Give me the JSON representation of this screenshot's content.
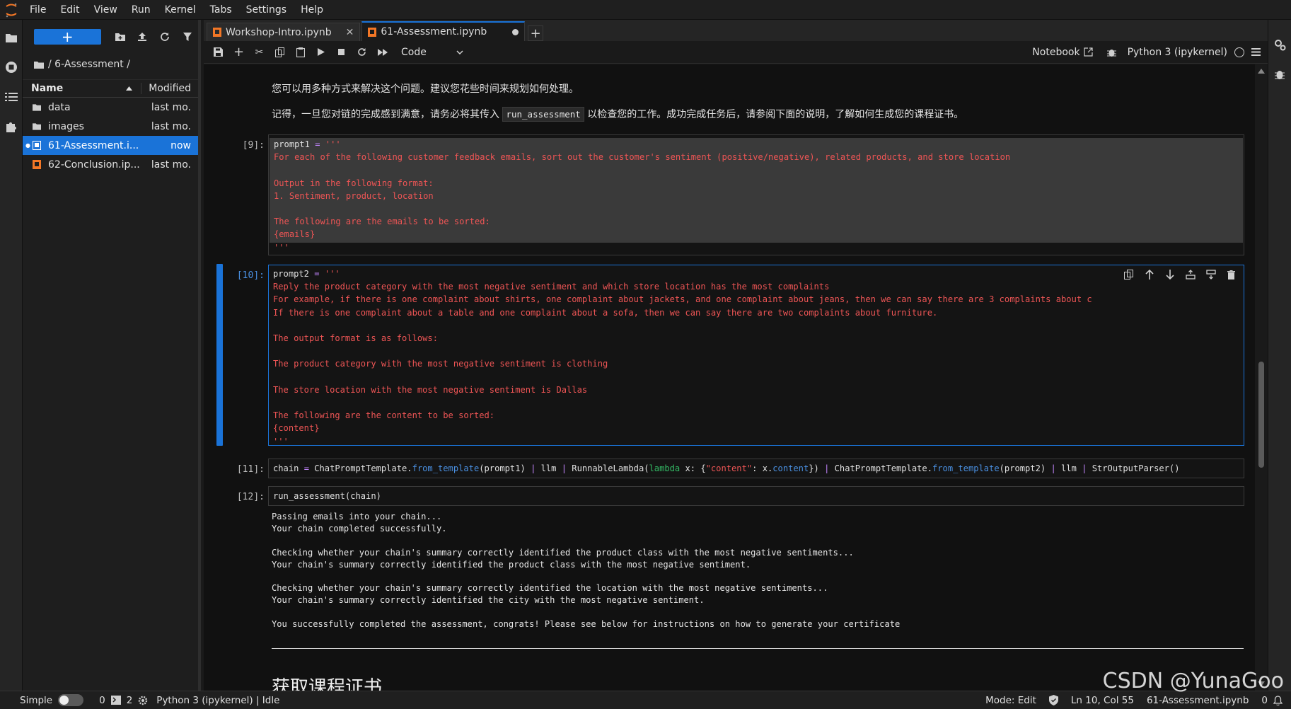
{
  "menubar": {
    "items": [
      "File",
      "Edit",
      "View",
      "Run",
      "Kernel",
      "Tabs",
      "Settings",
      "Help"
    ]
  },
  "filebrowser": {
    "new_label": "+",
    "path": "/ 6-Assessment /",
    "col_name": "Name",
    "col_modified": "Modified",
    "items": [
      {
        "name": "data",
        "modified": "last mo.",
        "type": "folder"
      },
      {
        "name": "images",
        "modified": "last mo.",
        "type": "folder"
      },
      {
        "name": "61-Assessment.i...",
        "modified": "now",
        "type": "notebook"
      },
      {
        "name": "62-Conclusion.ip...",
        "modified": "last mo.",
        "type": "notebook"
      }
    ]
  },
  "tabs": [
    {
      "label": "Workshop-Intro.ipynb",
      "active": false
    },
    {
      "label": "61-Assessment.ipynb",
      "active": true
    }
  ],
  "toolbar": {
    "cell_type": "Code",
    "notebook_label": "Notebook",
    "kernel_name": "Python 3 (ipykernel)"
  },
  "notebook": {
    "md_line1": "您可以用多种方式来解决这个问题。建议您花些时间来规划如何处理。",
    "md_line2_pre": "记得，一旦您对链的完成感到满意，请务必将其传入",
    "md_line2_code": "run_assessment",
    "md_line2_post": "以检查您的工作。成功完成任务后，请参阅下面的说明，了解如何生成您的课程证书。",
    "cell9_prompt": "[9]:",
    "cell10_prompt": "[10]:",
    "cell11_prompt": "[11]:",
    "cell12_prompt": "[12]:",
    "cell9_lines": [
      "For each of the following customer feedback emails, sort out the customer's sentiment (positive/negative), related products, and store location",
      "",
      "Output in the following format:",
      "1. Sentiment, product, location",
      "",
      "The following are the emails to be sorted:",
      "{emails}",
      "'''"
    ],
    "cell9_head_var": "prompt1",
    "cell10_head_var": "prompt2",
    "assign_op": "=",
    "triple_quote": "'''",
    "cell10_lines": [
      "Reply the product category with the most negative sentiment and which store location has the most complaints",
      "For example, if there is one complaint about shirts, one complaint about jackets, and one complaint about jeans, then we can say there are 3 complaints about c",
      "If there is one complaint about a table and one complaint about a sofa, then we can say there are two complaints about furniture.",
      "",
      "The output format is as follows:",
      "",
      "The product category with the most negative sentiment is clothing",
      "",
      "The store location with the most negative sentiment is Dallas",
      "",
      "The following are the content to be sorted:",
      "{content}",
      "'''"
    ],
    "cell11": {
      "t1": "chain ",
      "t2": "=",
      "t3": " ChatPromptTemplate.",
      "t4": "from_template",
      "t5": "(prompt1) ",
      "t6": "|",
      "t7": " llm ",
      "t8": "|",
      "t9": " RunnableLambda(",
      "t10": "lambda",
      "t11": " x: {",
      "t12": "\"content\"",
      "t13": ": x.",
      "t14": "content",
      "t15": "}) ",
      "t16": "|",
      "t17": " ChatPromptTemplate.",
      "t18": "from_template",
      "t19": "(prompt2) ",
      "t20": "|",
      "t21": " llm ",
      "t22": "|",
      "t23": " StrOutputParser()"
    },
    "cell12_code": "run_assessment(chain)",
    "output": "Passing emails into your chain...\nYour chain completed successfully.\n\nChecking whether your chain's summary correctly identified the product class with the most negative sentiments...\nYour chain's summary correctly identified the product class with the most negative sentiment.\n\nChecking whether your chain's summary correctly identified the location with the most negative sentiments...\nYour chain's summary correctly identified the city with the most negative sentiment.\n\nYou successfully completed the assessment, congrats! Please see below for instructions on how to generate your certificate",
    "heading": "获取课程证书"
  },
  "statusbar": {
    "mode_simple": "Simple",
    "count_a": "0",
    "count_b": "2",
    "kernel_status": "Python 3 (ipykernel) | Idle",
    "mode": "Mode: Edit",
    "position": "Ln 10, Col 55",
    "filename": "61-Assessment.ipynb",
    "notif_count": "0"
  },
  "watermark": "CSDN @YunaGoo",
  "colors": {
    "accent": "#1a73d8",
    "string": "#ee5555",
    "keyword": "#33b864",
    "function": "#4a90e2",
    "operator": "#c084fc"
  }
}
